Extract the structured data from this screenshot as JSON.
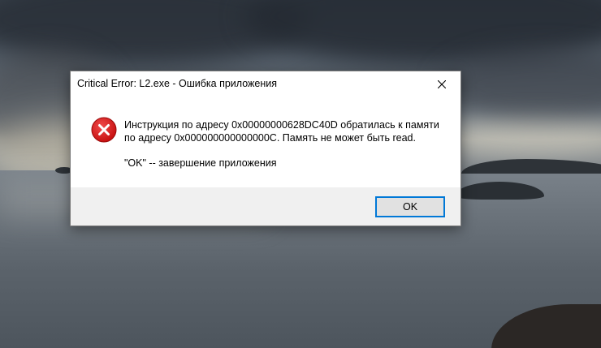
{
  "dialog": {
    "title": "Critical Error: L2.exe - Ошибка приложения",
    "icon": "error-icon",
    "message_line1": "Инструкция по адресу 0x00000000628DC40D обратилась к памяти по адресу 0x000000000000000C. Память не может быть read.",
    "message_hint": "\"OK\" -- завершение приложения",
    "ok_label": "OK",
    "close_icon": "close-icon"
  },
  "colors": {
    "error_red": "#e81123",
    "focus_blue": "#0078d7",
    "footer_bg": "#f0f0f0"
  }
}
